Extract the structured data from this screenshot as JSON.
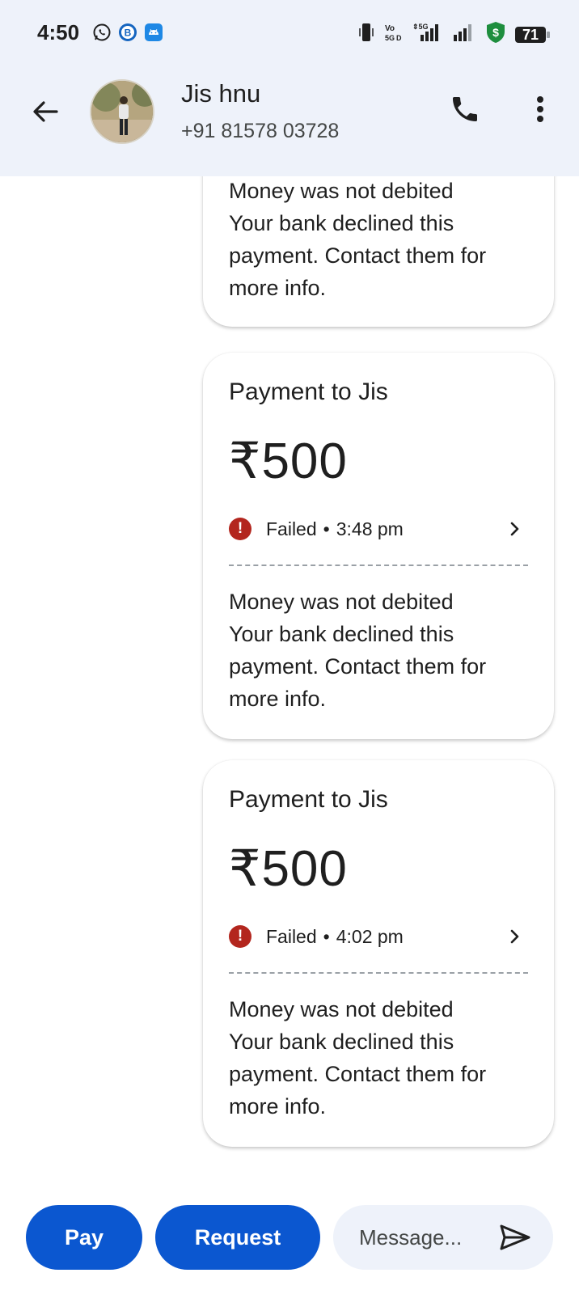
{
  "status_bar": {
    "time": "4:50",
    "app_icons": [
      "whatsapp-icon",
      "b-app-icon",
      "android-icon"
    ],
    "battery": "71"
  },
  "header": {
    "contact_name": "Jis hnu",
    "contact_phone": "+91 81578 03728"
  },
  "messages": [
    {
      "partial": true,
      "note_line1": "Money was not debited",
      "note_line2": "Your bank declined this payment. Contact them for more info."
    },
    {
      "title": "Payment to Jis",
      "amount": "₹500",
      "status": "Failed",
      "time": "3:48 pm",
      "note_line1": "Money was not debited",
      "note_line2": "Your bank declined this payment. Contact them for more info."
    },
    {
      "title": "Payment to Jis",
      "amount": "₹500",
      "status": "Failed",
      "time": "4:02 pm",
      "note_line1": "Money was not debited",
      "note_line2": "Your bank declined this payment. Contact them for more info."
    }
  ],
  "composer": {
    "pay_label": "Pay",
    "request_label": "Request",
    "message_placeholder": "Message..."
  },
  "colors": {
    "primary": "#0b57d0",
    "header_bg": "#eef2fa",
    "failed": "#b3261e"
  }
}
